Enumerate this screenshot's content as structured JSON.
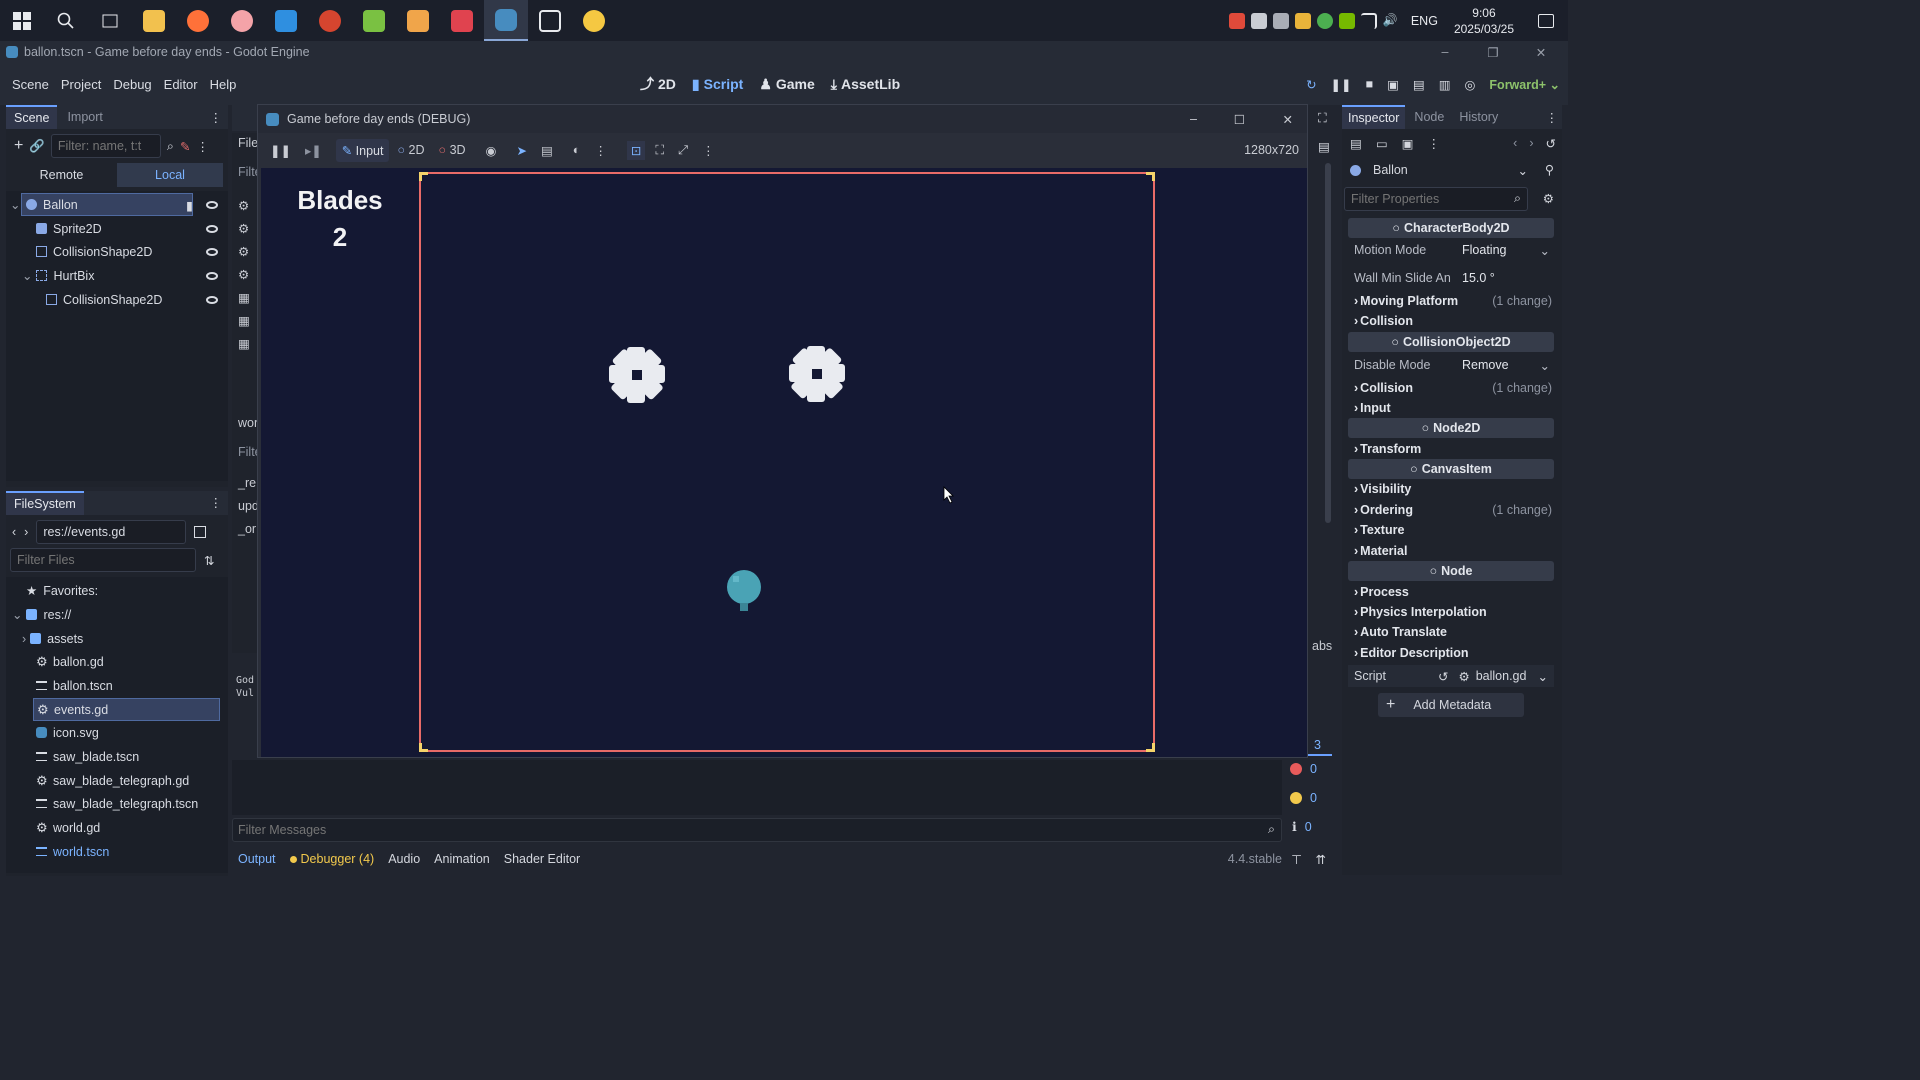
{
  "taskbar": {
    "apps": [
      "windows-start",
      "search",
      "task-view",
      "file-explorer",
      "firefox",
      "app-anime",
      "vscode",
      "app-red",
      "app-green",
      "app-orange",
      "app-news",
      "godot",
      "app-desktop",
      "app-bird"
    ],
    "tray": {
      "language": "ENG",
      "time": "9:06",
      "date": "2025/03/25"
    }
  },
  "window": {
    "title": "ballon.tscn - Game before day ends - Godot Engine"
  },
  "menu": {
    "items": [
      "Scene",
      "Project",
      "Debug",
      "Editor",
      "Help"
    ]
  },
  "workspaces": {
    "two_d": "2D",
    "script": "Script",
    "game": "Game",
    "assetlib": "AssetLib"
  },
  "renderer": "Forward+",
  "scene_dock": {
    "tabs": [
      "Scene",
      "Import"
    ],
    "filter_placeholder": "Filter: name, t:t",
    "remote_label": "Remote",
    "local_label": "Local",
    "nodes": [
      {
        "name": "Ballon",
        "depth": 0,
        "type": "character"
      },
      {
        "name": "Sprite2D",
        "depth": 1,
        "type": "sprite"
      },
      {
        "name": "CollisionShape2D",
        "depth": 1,
        "type": "shape"
      },
      {
        "name": "HurtBix",
        "depth": 1,
        "type": "area"
      },
      {
        "name": "CollisionShape2D",
        "depth": 2,
        "type": "shape"
      }
    ]
  },
  "filesystem": {
    "tab": "FileSystem",
    "path": "res://events.gd",
    "filter_placeholder": "Filter Files",
    "favorites": "Favorites:",
    "root": "res://",
    "items": [
      {
        "name": "assets",
        "kind": "folder"
      },
      {
        "name": "ballon.gd",
        "kind": "script"
      },
      {
        "name": "ballon.tscn",
        "kind": "scene"
      },
      {
        "name": "events.gd",
        "kind": "script",
        "selected": true
      },
      {
        "name": "icon.svg",
        "kind": "image"
      },
      {
        "name": "saw_blade.tscn",
        "kind": "scene"
      },
      {
        "name": "saw_blade_telegraph.gd",
        "kind": "script"
      },
      {
        "name": "saw_blade_telegraph.tscn",
        "kind": "scene"
      },
      {
        "name": "world.gd",
        "kind": "script"
      },
      {
        "name": "world.tscn",
        "kind": "scene",
        "highlight": true
      }
    ]
  },
  "script_panel_fragments": [
    "File",
    "Filte",
    "wor",
    "Filte",
    "_re",
    "upd",
    "_or",
    "God",
    "Vul",
    "abs"
  ],
  "game_window": {
    "title": "Game before day ends (DEBUG)",
    "toolbar": {
      "input": "Input",
      "two_d": "2D",
      "three_d": "3D",
      "resolution": "1280x720"
    },
    "hud": {
      "label": "Blades",
      "value": "2"
    }
  },
  "bottom_panel": {
    "filter_placeholder": "Filter Messages",
    "tabs": [
      "Output",
      "Debugger (4)",
      "Audio",
      "Animation",
      "Shader Editor"
    ],
    "version": "4.4.stable",
    "counts": {
      "messages": "3",
      "errors": "0",
      "warnings": "0",
      "info": "0"
    }
  },
  "inspector": {
    "tabs": [
      "Inspector",
      "Node",
      "History"
    ],
    "object": "Ballon",
    "filter_placeholder": "Filter Properties",
    "sections": [
      {
        "kind": "header",
        "label": "CharacterBody2D"
      },
      {
        "kind": "prop",
        "label": "Motion Mode",
        "value": "Floating"
      },
      {
        "kind": "prop",
        "label": "Wall Min Slide An",
        "value": "15.0 °"
      },
      {
        "kind": "cat",
        "label": "Moving Platform",
        "note": "(1 change)"
      },
      {
        "kind": "cat",
        "label": "Collision",
        "note": ""
      },
      {
        "kind": "header",
        "label": "CollisionObject2D"
      },
      {
        "kind": "prop",
        "label": "Disable Mode",
        "value": "Remove"
      },
      {
        "kind": "cat",
        "label": "Collision",
        "note": "(1 change)"
      },
      {
        "kind": "cat",
        "label": "Input",
        "note": ""
      },
      {
        "kind": "header",
        "label": "Node2D"
      },
      {
        "kind": "cat",
        "label": "Transform",
        "note": ""
      },
      {
        "kind": "header",
        "label": "CanvasItem"
      },
      {
        "kind": "cat",
        "label": "Visibility",
        "note": ""
      },
      {
        "kind": "cat",
        "label": "Ordering",
        "note": "(1 change)"
      },
      {
        "kind": "cat",
        "label": "Texture",
        "note": ""
      },
      {
        "kind": "cat",
        "label": "Material",
        "note": ""
      },
      {
        "kind": "header",
        "label": "Node"
      },
      {
        "kind": "cat",
        "label": "Process",
        "note": ""
      },
      {
        "kind": "cat",
        "label": "Physics Interpolation",
        "note": ""
      },
      {
        "kind": "cat",
        "label": "Auto Translate",
        "note": ""
      },
      {
        "kind": "cat",
        "label": "Editor Description",
        "note": ""
      }
    ],
    "script_label": "Script",
    "script_value": "ballon.gd",
    "add_metadata": "Add Metadata"
  },
  "colors": {
    "accent": "#6aa0ff",
    "arena_border": "#e96b68",
    "corner": "#f5d36a",
    "viewport_bg": "#141833",
    "balloon": "#4aa3b5"
  }
}
